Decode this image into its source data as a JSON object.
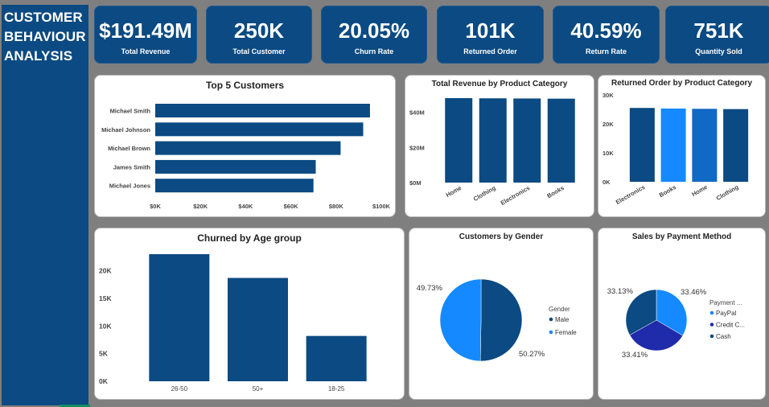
{
  "sidebar": {
    "title_lines": [
      "CUSTOMER",
      "BEHAVIOUR",
      "ANALYSIS"
    ]
  },
  "kpis": [
    {
      "value": "$191.49M",
      "label": "Total Revenue"
    },
    {
      "value": "250K",
      "label": "Total Customer"
    },
    {
      "value": "20.05%",
      "label": "Churn Rate"
    },
    {
      "value": "101K",
      "label": "Returned Order"
    },
    {
      "value": "40.59%",
      "label": "Return Rate"
    },
    {
      "value": "751K",
      "label": "Quantity Sold"
    }
  ],
  "colors": {
    "navy": "#0b4a82",
    "blue": "#1589ff",
    "darkblue": "#1f2bab",
    "midblue": "#1069c4"
  },
  "chart_data": [
    {
      "id": "top5",
      "type": "bar",
      "orientation": "horizontal",
      "title": "Top 5 Customers",
      "categories": [
        "Michael Smith",
        "Michael Johnson",
        "Michael Brown",
        "James Smith",
        "Michael Jones"
      ],
      "values": [
        95000,
        92000,
        82000,
        71000,
        70000
      ],
      "xlim": [
        0,
        100000
      ],
      "tick_labels": [
        "$0K",
        "$20K",
        "$40K",
        "$60K",
        "$80K",
        "$100K"
      ]
    },
    {
      "id": "revcat",
      "type": "bar",
      "title": "Total Revenue by Product Category",
      "categories": [
        "Home",
        "Clothing",
        "Electronics",
        "Books"
      ],
      "values": [
        48000000,
        47900000,
        47800000,
        47700000
      ],
      "ylim": [
        0,
        48000000
      ],
      "tick_labels": [
        "$0M",
        "$20M",
        "$40M"
      ]
    },
    {
      "id": "retcat",
      "type": "bar",
      "title": "Returned Order by Product Category",
      "categories": [
        "Electronics",
        "Books",
        "Home",
        "Clothing"
      ],
      "values": [
        25500,
        25300,
        25200,
        25100
      ],
      "ylim": [
        0,
        30000
      ],
      "tick_labels": [
        "0K",
        "10K",
        "20K",
        "30K"
      ],
      "highlight_index": 1
    },
    {
      "id": "age",
      "type": "bar",
      "title": "Churned by Age group",
      "categories": [
        "26-50",
        "50+",
        "18-25"
      ],
      "values": [
        23000,
        18700,
        8200
      ],
      "ylim": [
        0,
        23000
      ],
      "tick_labels": [
        "0K",
        "5K",
        "10K",
        "15K",
        "20K"
      ]
    },
    {
      "id": "gender",
      "type": "pie",
      "title": "Customers by Gender",
      "legend_title": "Gender",
      "slices": [
        {
          "label": "Male",
          "value": 50.27,
          "display": "50.27%"
        },
        {
          "label": "Female",
          "value": 49.73,
          "display": "49.73%"
        }
      ]
    },
    {
      "id": "payment",
      "type": "pie",
      "title": "Sales by Payment Method",
      "legend_title": "Payment ...",
      "slices": [
        {
          "label": "PayPal",
          "value": 33.46,
          "display": "33.46%"
        },
        {
          "label": "Credit C...",
          "value": 33.41,
          "display": "33.41%"
        },
        {
          "label": "Cash",
          "value": 33.13,
          "display": "33.13%"
        }
      ]
    }
  ]
}
